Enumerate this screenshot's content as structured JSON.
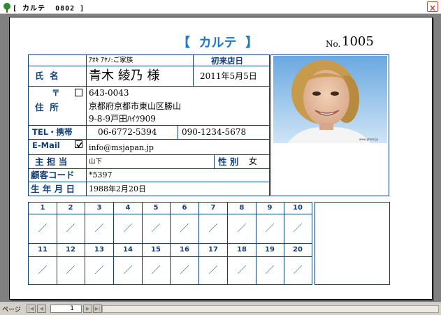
{
  "window": {
    "title": "[ カルテ  0802 ]"
  },
  "header": {
    "title": "【  カルテ  】",
    "no_label": "No.",
    "no_value": "1005"
  },
  "customer": {
    "furigana": "ｱｵｷ ｱﾔﾉ:ご家族",
    "name_label": "氏  名",
    "name": "青木 綾乃 様",
    "first_visit_label": "初来店日",
    "first_visit": "2011年5月5日",
    "postal_mark": "〒",
    "postal_code": "643-0043",
    "address_label": "住  所",
    "address_line1": "京都府京都市東山区勝山",
    "address_line2": "9-8-9戸田ﾊｲﾂ909",
    "tel_label": "TEL・携帯",
    "tel": "06-6772-5394",
    "mobile": "090-1234-5678",
    "email_label": "E-Mail",
    "email": "info@msjapan.jp",
    "staff_label": "主 担 当",
    "staff": "山下",
    "gender_label": "性 別",
    "gender": "女",
    "customer_code_label": "顧客コード",
    "customer_code": "*5397",
    "birthdate_label": "生 年 月 日",
    "birthdate": "1988年2月20日"
  },
  "visits": {
    "row1": [
      "1",
      "2",
      "3",
      "4",
      "5",
      "6",
      "7",
      "8",
      "9",
      "10"
    ],
    "row2": [
      "11",
      "12",
      "13",
      "14",
      "15",
      "16",
      "17",
      "18",
      "19",
      "20"
    ],
    "date_placeholder": "／"
  },
  "statusbar": {
    "page_label": "ページ",
    "page_number": "1",
    "first": "|◀",
    "prev": "◀",
    "next": "▶",
    "last": "▶|"
  }
}
